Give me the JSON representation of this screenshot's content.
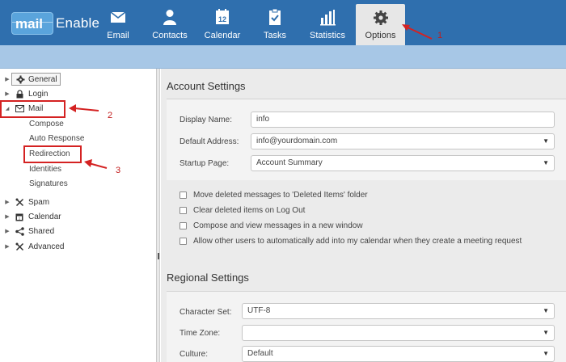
{
  "app": {
    "logo_mail": "mail",
    "logo_enable": "Enable"
  },
  "nav": {
    "items": [
      {
        "label": "Email",
        "icon": "envelope-icon"
      },
      {
        "label": "Contacts",
        "icon": "person-icon"
      },
      {
        "label": "Calendar",
        "icon": "calendar-icon",
        "badge": "12"
      },
      {
        "label": "Tasks",
        "icon": "clipboard-check-icon"
      },
      {
        "label": "Statistics",
        "icon": "bar-chart-icon"
      },
      {
        "label": "Options",
        "icon": "gear-icon",
        "active": true
      }
    ]
  },
  "sidebar": {
    "items": [
      {
        "label": "General",
        "icon": "gear-icon"
      },
      {
        "label": "Login",
        "icon": "lock-icon"
      },
      {
        "label": "Mail",
        "icon": "envelope-icon",
        "expanded": true
      },
      {
        "label": "Spam",
        "icon": "tools-icon"
      },
      {
        "label": "Calendar",
        "icon": "calendar-icon"
      },
      {
        "label": "Shared",
        "icon": "share-icon"
      },
      {
        "label": "Advanced",
        "icon": "tools-icon"
      }
    ],
    "mail_children": [
      "Compose",
      "Auto Response",
      "Redirection",
      "Identities",
      "Signatures"
    ]
  },
  "annotations": {
    "n1": "1",
    "n2": "2",
    "n3": "3"
  },
  "account": {
    "title": "Account Settings",
    "display_name_label": "Display Name:",
    "display_name_value": "info",
    "default_address_label": "Default Address:",
    "default_address_value": "info@yourdomain.com",
    "startup_page_label": "Startup Page:",
    "startup_page_value": "Account Summary",
    "checks": [
      "Move deleted messages to 'Deleted Items' folder",
      "Clear deleted items on Log Out",
      "Compose and view messages in a new window",
      "Allow other users to automatically add into my calendar when they create a meeting request"
    ]
  },
  "regional": {
    "title": "Regional Settings",
    "charset_label": "Character Set:",
    "charset_value": "UTF-8",
    "timezone_label": "Time Zone:",
    "timezone_value": "",
    "culture_label": "Culture:",
    "culture_value": "Default"
  },
  "colors": {
    "header": "#2f6fae",
    "subbar": "#a7c7e6",
    "annotation_red": "#d42222"
  }
}
